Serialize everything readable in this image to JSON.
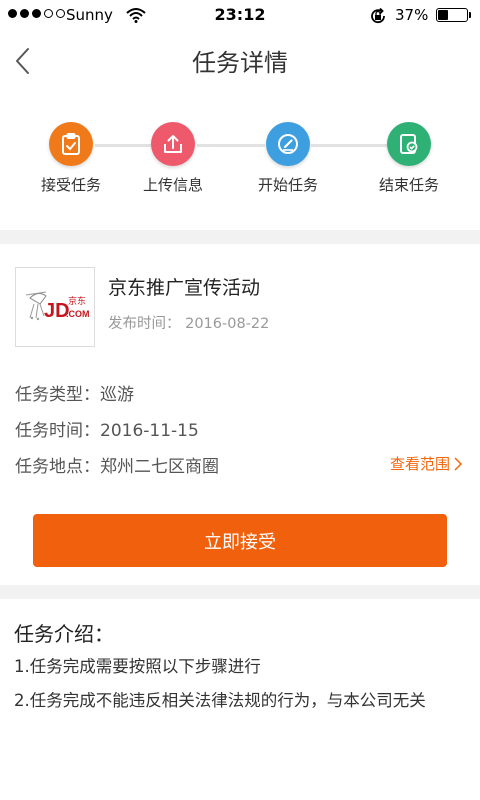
{
  "status_bar": {
    "carrier": "Sunny",
    "time": "23:12",
    "battery_percent": "37%",
    "battery_level": 0.37,
    "signal_bars": 3,
    "signal_total": 5
  },
  "nav": {
    "title": "任务详情",
    "back_icon": "chevron-left-icon"
  },
  "steps": [
    {
      "label": "接受任务",
      "icon": "clipboard-check-icon",
      "color": "#f07a1a"
    },
    {
      "label": "上传信息",
      "icon": "upload-icon",
      "color": "#ee5a6b"
    },
    {
      "label": "开始任务",
      "icon": "pen-icon",
      "color": "#3d9ee0"
    },
    {
      "label": "结束任务",
      "icon": "check-card-icon",
      "color": "#2fb074"
    }
  ],
  "task": {
    "logo": {
      "brand_text": "JD",
      "brand_cn": "京东",
      "domain": ".COM"
    },
    "name": "京东推广宣传活动",
    "publish_label": "发布时间：",
    "publish_date": "2016-08-22",
    "type_label": "任务类型：",
    "type_value": "巡游",
    "time_label": "任务时间：",
    "time_value": "2016-11-15",
    "location_label": "任务地点：",
    "location_value": "郑州二七区商圈",
    "view_range": "查看范围",
    "accept_button": "立即接受"
  },
  "intro": {
    "title": "任务介绍：",
    "items": [
      "1.任务完成需要按照以下步骤进行",
      "2.任务完成不能违反相关法律法规的行为，与本公司无关"
    ]
  },
  "colors": {
    "accent": "#f1600c",
    "divider_bg": "#f2f2f2"
  }
}
